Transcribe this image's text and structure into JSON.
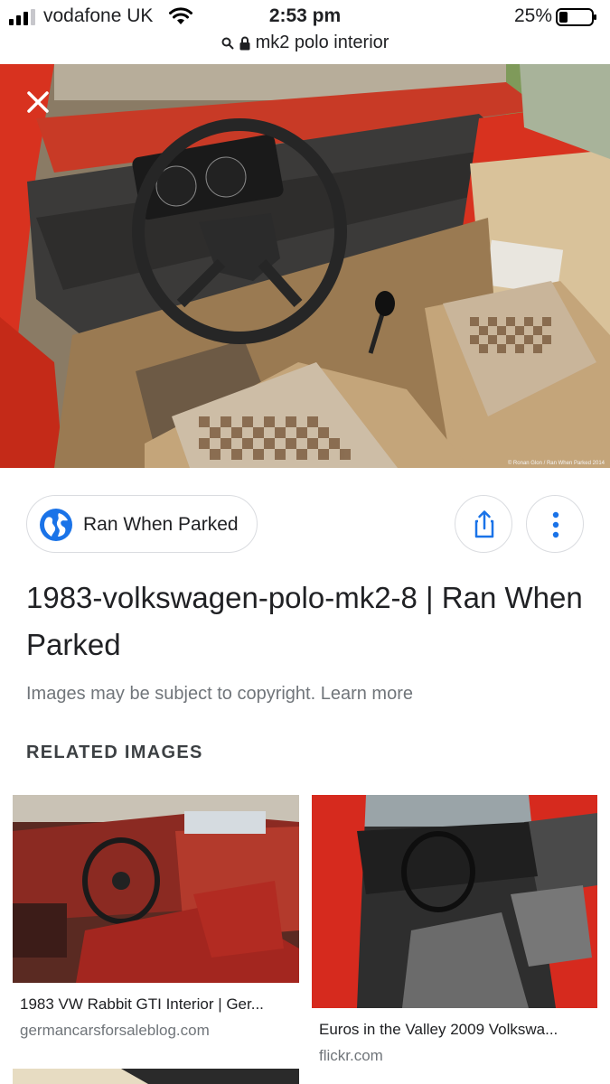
{
  "status_bar": {
    "carrier": "vodafone UK",
    "time": "2:53 pm",
    "battery": "25%"
  },
  "url_bar": {
    "text": "mk2 polo interior"
  },
  "hero": {
    "credit": "© Ronan Glon / Ran When Parked 2014"
  },
  "source": {
    "label": "Ran When Parked"
  },
  "result": {
    "title": "1983-volkswagen-polo-mk2-8 | Ran When Parked",
    "copyright_text": "Images may be subject to copyright.",
    "learn_more": "Learn more"
  },
  "related": {
    "heading": "RELATED IMAGES",
    "items": [
      {
        "title": "1983 VW Rabbit GTI Interior | Ger...",
        "domain": "germancarsforsaleblog.com"
      },
      {
        "title": "Euros in the Valley 2009 Volkswa...",
        "domain": "flickr.com"
      }
    ]
  },
  "colors": {
    "accent_blue": "#1a73e8",
    "car_red": "#d8321f",
    "text_primary": "#202124",
    "text_secondary": "#70757a"
  }
}
